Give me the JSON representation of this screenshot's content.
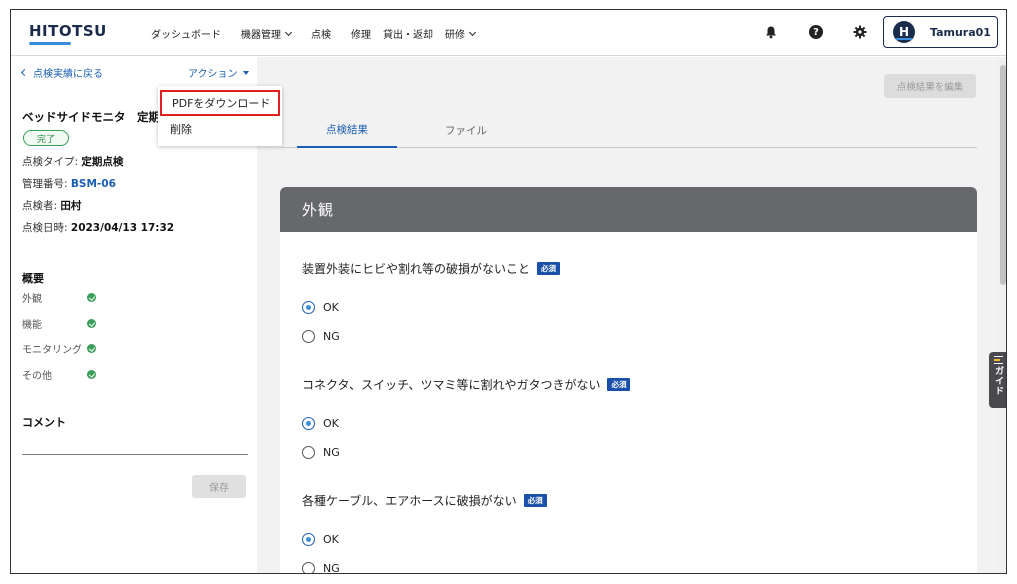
{
  "header": {
    "logo": "HITOTSU",
    "nav": [
      {
        "label": "ダッシュボード",
        "dropdown": false
      },
      {
        "label": "機器管理",
        "dropdown": true
      },
      {
        "label": "点検",
        "dropdown": false
      },
      {
        "label": "修理",
        "dropdown": false
      },
      {
        "label": "貸出・返却",
        "dropdown": false
      },
      {
        "label": "研修",
        "dropdown": true
      }
    ],
    "help_glyph": "?",
    "user": {
      "initial": "H",
      "name": "Tamura01"
    }
  },
  "left": {
    "back_label": "点検実績に戻る",
    "action_label": "アクション",
    "device_title": "ベッドサイドモニタ　定期点検",
    "status": "完了",
    "meta": {
      "type_label": "点検タイプ: ",
      "type_value": "定期点検",
      "id_label": "管理番号: ",
      "id_value": "BSM-06",
      "inspector_label": "点検者: ",
      "inspector_value": "田村",
      "date_label": "点検日時: ",
      "date_value": "2023/04/13 17:32"
    },
    "summary_title": "概要",
    "summary": [
      {
        "label": "外観"
      },
      {
        "label": "機能"
      },
      {
        "label": "モニタリング"
      },
      {
        "label": "その他"
      }
    ],
    "comment_title": "コメント",
    "save_label": "保存"
  },
  "dropdown": {
    "items": [
      "PDFをダウンロード",
      "削除"
    ],
    "highlight_color": "#e02020"
  },
  "main": {
    "edit_label": "点検結果を編集",
    "tabs": [
      "点検結果",
      "ファイル"
    ],
    "section_title": "外観",
    "required_label": "必須",
    "ok_label": "OK",
    "ng_label": "NG",
    "questions": [
      {
        "text": "装置外装にヒビや割れ等の破損がないこと",
        "selected": "OK"
      },
      {
        "text": "コネクタ、スイッチ、ツマミ等に割れやガタつきがない",
        "selected": "OK"
      },
      {
        "text": "各種ケーブル、エアホースに破損がない",
        "selected": "OK"
      }
    ]
  },
  "guide_label": "ガイド",
  "colors": {
    "brand": "#1a2b4c",
    "accent": "#3b8fd8",
    "link": "#1a5fb4",
    "success": "#3a9e5a",
    "section_header": "#66686c",
    "required_badge": "#1a4faa"
  }
}
